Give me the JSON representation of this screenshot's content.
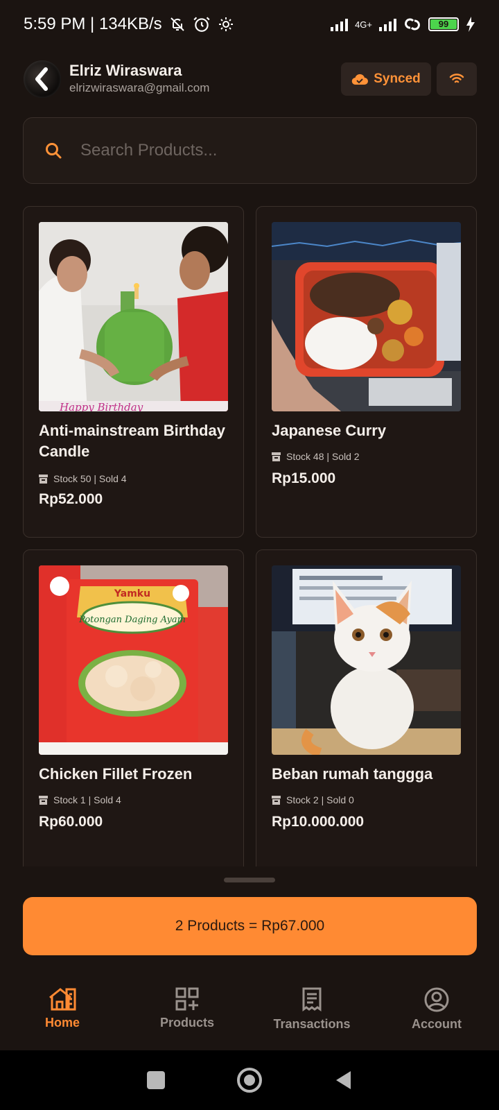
{
  "status_bar": {
    "time_speed": "5:59 PM | 134KB/s",
    "network": "4G+",
    "battery": "99"
  },
  "header": {
    "user_name": "Elriz Wiraswara",
    "user_email": "elrizwiraswara@gmail.com",
    "synced_label": "Synced"
  },
  "search": {
    "placeholder": "Search Products..."
  },
  "products": [
    {
      "title": "Anti-mainstream Birthday Candle",
      "meta": "Stock 50  |  Sold 4",
      "price": "Rp52.000"
    },
    {
      "title": "Japanese Curry",
      "meta": "Stock 48  |  Sold 2",
      "price": "Rp15.000"
    },
    {
      "title": "Chicken Fillet Frozen",
      "meta": "Stock 1  |  Sold 4",
      "price": "Rp60.000"
    },
    {
      "title": "Beban rumah tanggga",
      "meta": "Stock 2  |  Sold 0",
      "price": "Rp10.000.000"
    }
  ],
  "cart": {
    "summary": "2 Products = Rp67.000"
  },
  "bottom_nav": {
    "items": [
      {
        "label": "Home",
        "icon": "home-icon"
      },
      {
        "label": "Products",
        "icon": "qr-add-icon"
      },
      {
        "label": "Transactions",
        "icon": "receipt-icon"
      },
      {
        "label": "Account",
        "icon": "account-icon"
      }
    ],
    "active": "Home"
  },
  "colors": {
    "background": "#1b1411",
    "accent": "#ff8a33",
    "card": "#1f1714",
    "muted": "#9a928d"
  }
}
